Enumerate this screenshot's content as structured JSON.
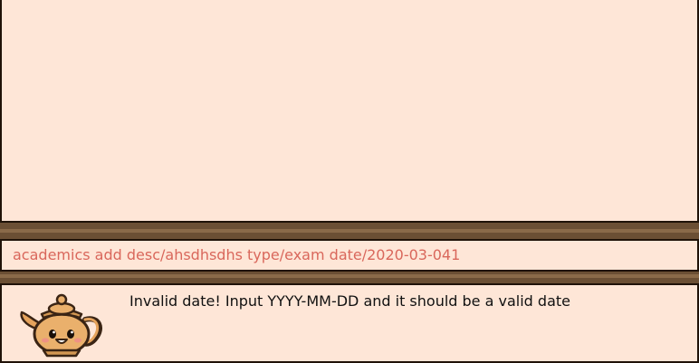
{
  "command_box": {
    "value": "academics add desc/ahsdhsdhs type/exam date/2020-03-041"
  },
  "result_display": {
    "message": "Invalid date! Input YYYY-MM-DD and it should be a valid date",
    "mascot_icon": "teapot-mascot-icon"
  },
  "colors": {
    "background": "#fee6d7",
    "border": "#6b4f34",
    "command_text": "#d9675b"
  }
}
